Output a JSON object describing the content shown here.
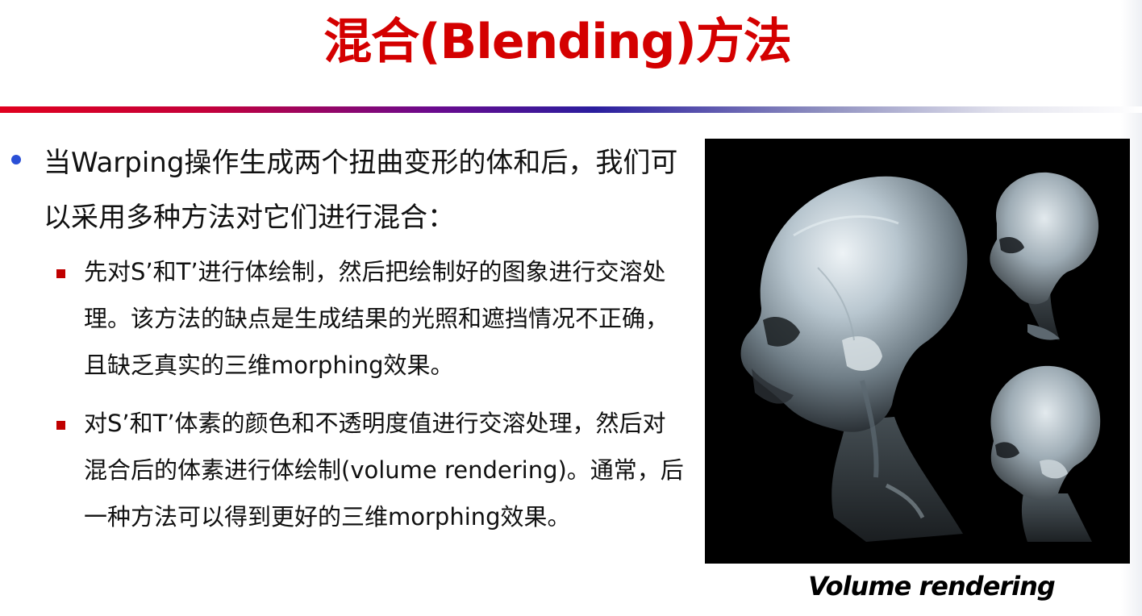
{
  "slide": {
    "title": "混合(Blending)方法"
  },
  "main_bullet": {
    "text": "当Warping操作生成两个扭曲变形的体和后，我们可以采用多种方法对它们进行混合："
  },
  "sub_bullets": [
    {
      "text": "先对S’和T’进行体绘制，然后把绘制好的图象进行交溶处理。该方法的缺点是生成结果的光照和遮挡情况不正确，且缺乏真实的三维morphing效果。"
    },
    {
      "text": "对S’和T’体素的颜色和不透明度值进行交溶处理，然后对混合后的体素进行体绘制(volume rendering)。通常，后一种方法可以得到更好的三维morphing效果。"
    }
  ],
  "figure": {
    "caption": "Volume rendering",
    "background": "#000000"
  },
  "colors": {
    "title": "#d40000",
    "main_bullet_dot": "#2a4fd6",
    "sub_bullet_square": "#c00000"
  }
}
